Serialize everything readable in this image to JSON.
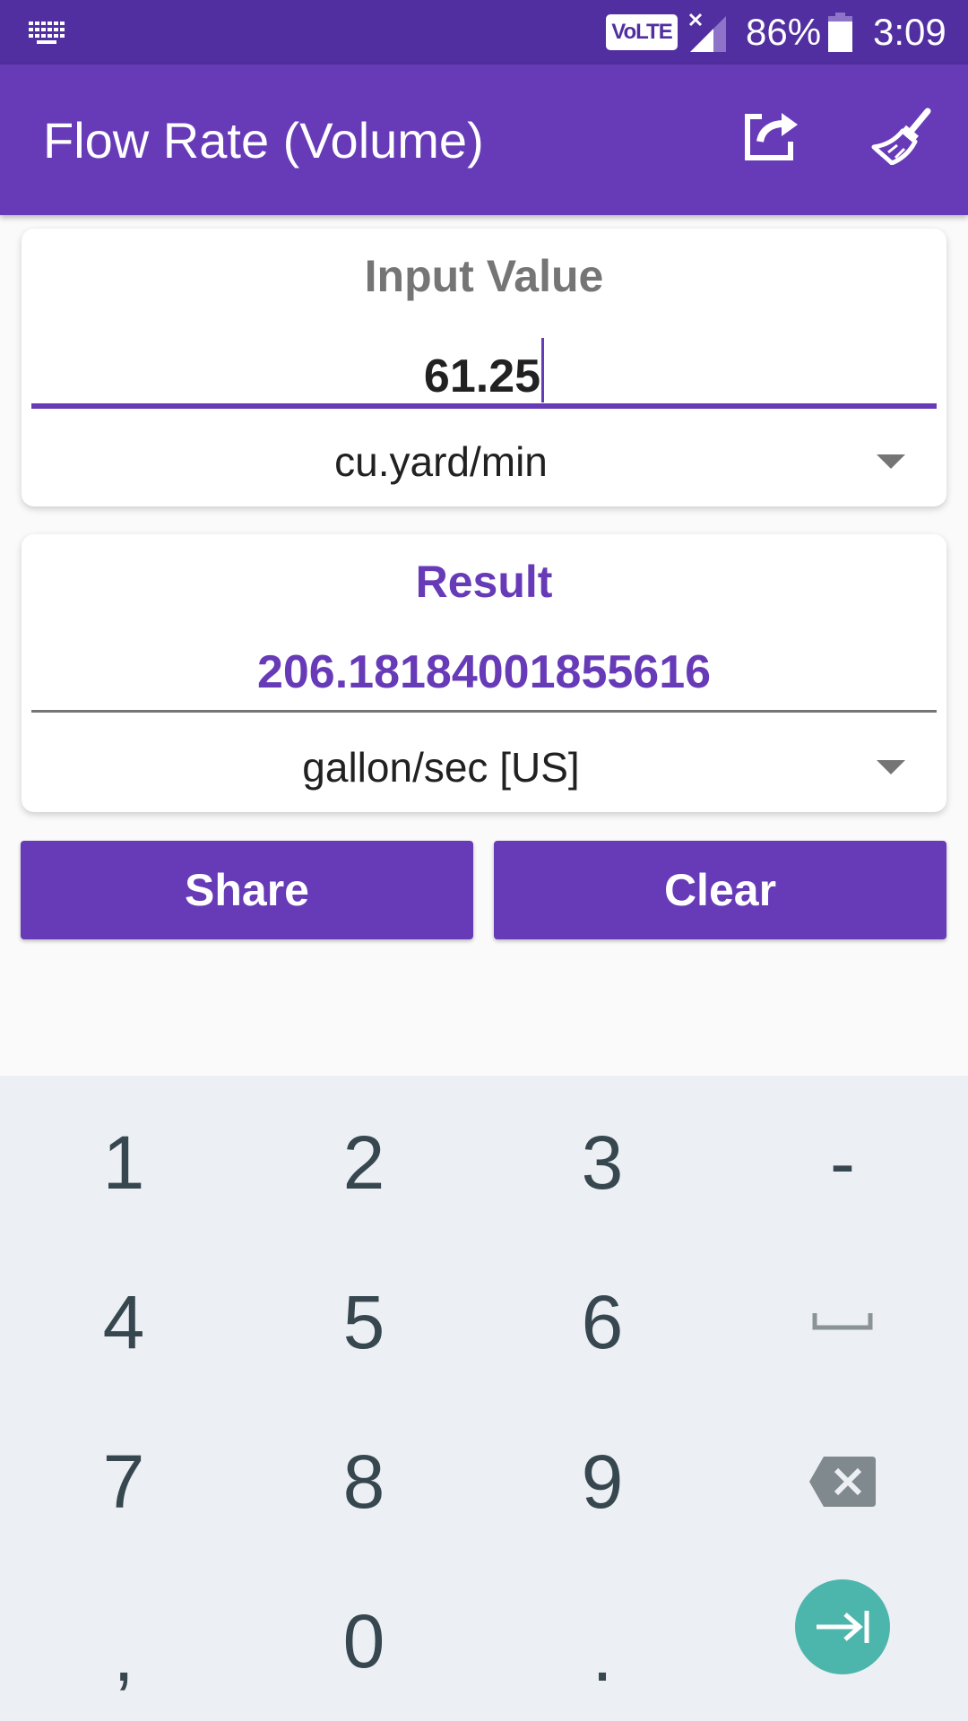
{
  "status_bar": {
    "keyboard_icon": "keyboard-icon",
    "network_badge": "VoLTE",
    "signal_icon": "signal-no-service-icon",
    "battery_percent": "86%",
    "battery_icon": "battery-icon",
    "time": "3:09",
    "color": "#512FA0"
  },
  "app_bar": {
    "title": "Flow Rate (Volume)",
    "actions": [
      {
        "name": "share",
        "icon": "share-icon"
      },
      {
        "name": "clear",
        "icon": "broom-icon"
      }
    ],
    "color": "#673AB7"
  },
  "input_card": {
    "label": "Input Value",
    "value": "61.25",
    "unit": "cu.yard/min"
  },
  "result_card": {
    "label": "Result",
    "value": "206.18184001855616",
    "unit": "gallon/sec [US]"
  },
  "buttons": {
    "share_label": "Share",
    "clear_label": "Clear"
  },
  "keyboard": {
    "rows": [
      [
        "1",
        "2",
        "3",
        "-"
      ],
      [
        "4",
        "5",
        "6",
        "space"
      ],
      [
        "7",
        "8",
        "9",
        "backspace"
      ],
      [
        ",",
        "0",
        ".",
        "next"
      ]
    ],
    "keys": {
      "k1": "1",
      "k2": "2",
      "k3": "3",
      "minus": "-",
      "k4": "4",
      "k5": "5",
      "k6": "6",
      "k7": "7",
      "k8": "8",
      "k9": "9",
      "comma": ",",
      "k0": "0",
      "dot": "."
    },
    "enter_color": "#4DB6AC"
  }
}
